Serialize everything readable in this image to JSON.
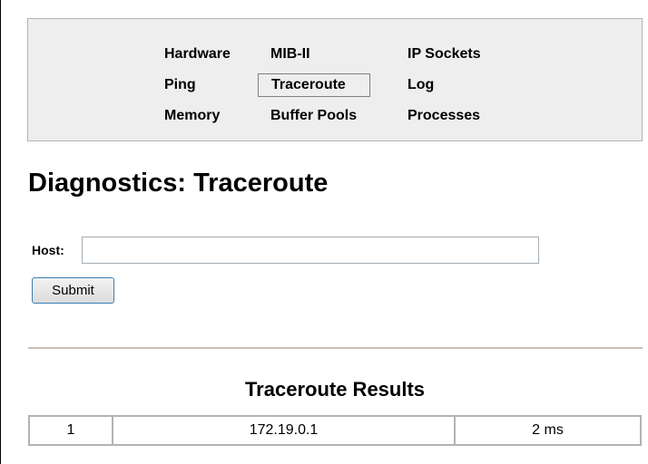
{
  "nav": {
    "items": [
      {
        "label": "Hardware"
      },
      {
        "label": "MIB-II"
      },
      {
        "label": "IP Sockets"
      },
      {
        "label": "Ping"
      },
      {
        "label": "Traceroute"
      },
      {
        "label": "Log"
      },
      {
        "label": "Memory"
      },
      {
        "label": "Buffer Pools"
      },
      {
        "label": "Processes"
      }
    ],
    "active": "Traceroute"
  },
  "page": {
    "title": "Diagnostics: Traceroute"
  },
  "form": {
    "host_label": "Host:",
    "host_value": "",
    "submit_label": "Submit"
  },
  "results": {
    "title": "Traceroute Results",
    "rows": [
      {
        "hop": "1",
        "address": "172.19.0.1",
        "time": "2 ms"
      }
    ]
  }
}
